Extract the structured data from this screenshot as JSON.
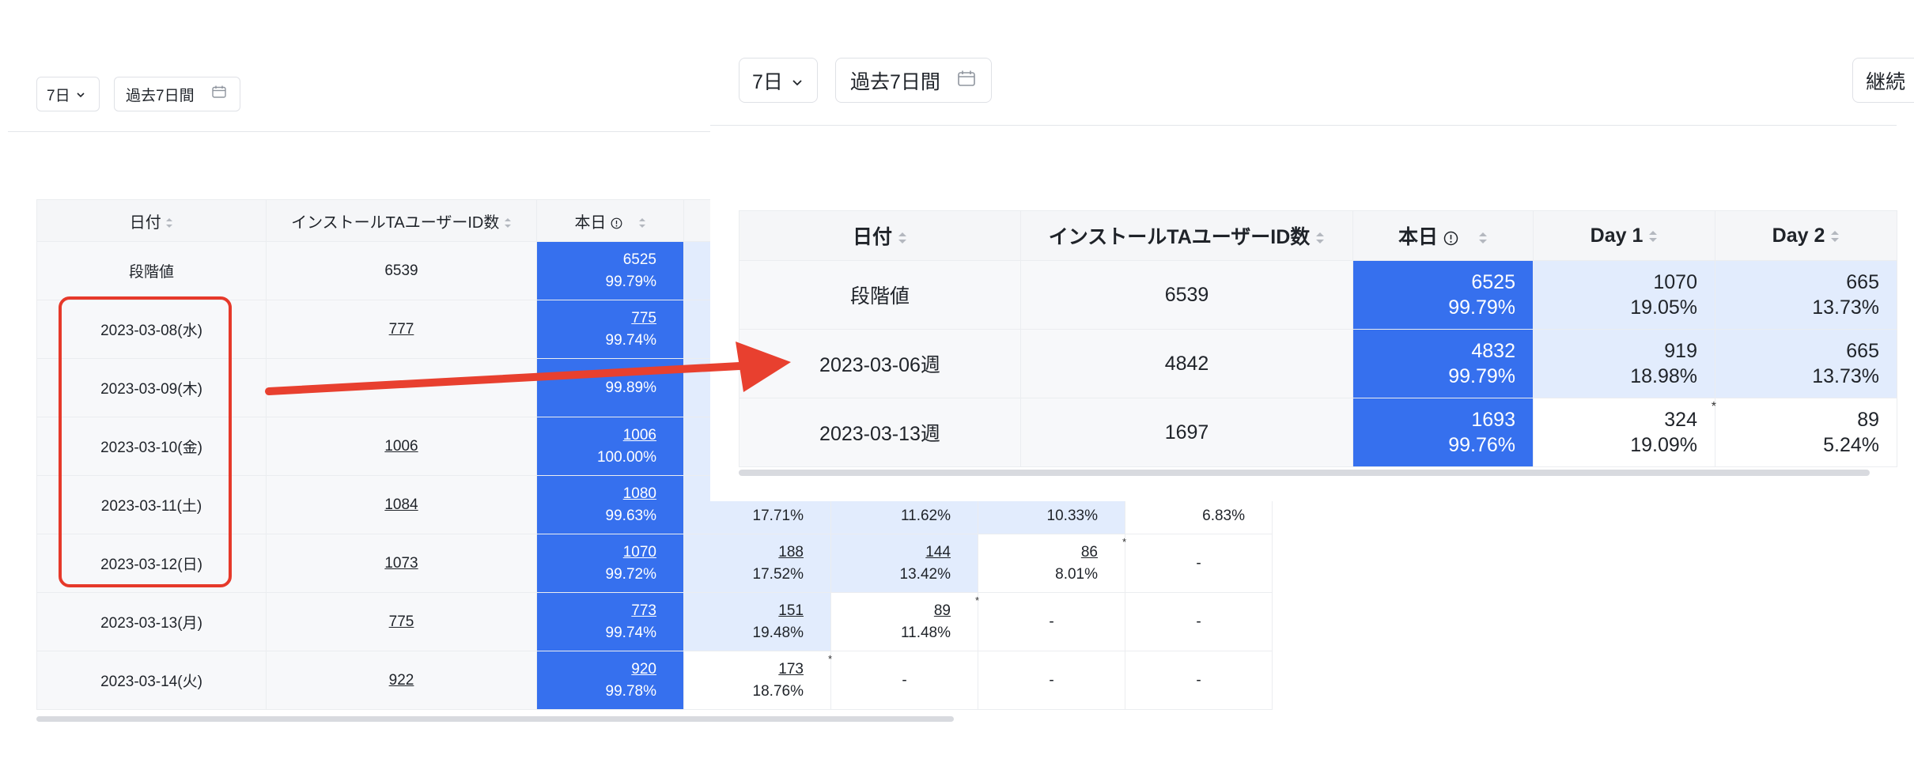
{
  "colors": {
    "accent_blue": "#3670ee",
    "light_blue": "#e2ecfd",
    "highlight_red": "#e6392a",
    "arrow_red": "#e8402f"
  },
  "left": {
    "controls": {
      "period": "7日",
      "range": "過去7日間"
    },
    "headers": {
      "date": "日付",
      "installs": "インストールTAユーザーID数",
      "today": "本日"
    },
    "rows": [
      {
        "date": "段階値",
        "installs": "6539",
        "today": "6525",
        "today_pct": "99.79%"
      },
      {
        "date": "2023-03-08(水)",
        "installs": "777",
        "today": "775",
        "today_pct": "99.74%"
      },
      {
        "date": "2023-03-09(木)",
        "installs": "",
        "today": "",
        "today_pct": "99.89%"
      },
      {
        "date": "2023-03-10(金)",
        "installs": "1006",
        "today": "1006",
        "today_pct": "100.00%"
      },
      {
        "date": "2023-03-11(土)",
        "installs": "1084",
        "today": "1080",
        "today_pct": "99.63%",
        "c1_pct": "17.71%",
        "c2_pct": "11.62%",
        "c3_pct": "10.33%",
        "c4_pct": "6.83%"
      },
      {
        "date": "2023-03-12(日)",
        "installs": "1073",
        "today": "1070",
        "today_pct": "99.72%",
        "c1": "188",
        "c1_pct": "17.52%",
        "c2": "144",
        "c2_pct": "13.42%",
        "c3": "86",
        "c3_pct": "8.01%",
        "c4": "-"
      },
      {
        "date": "2023-03-13(月)",
        "installs": "775",
        "today": "773",
        "today_pct": "99.74%",
        "c1": "151",
        "c1_pct": "19.48%",
        "c2": "89",
        "c2_pct": "11.48%",
        "c3": "-",
        "c4": "-"
      },
      {
        "date": "2023-03-14(火)",
        "installs": "922",
        "today": "920",
        "today_pct": "99.78%",
        "c1": "173",
        "c1_pct": "18.76%",
        "c2": "-",
        "c3": "-",
        "c4": "-"
      }
    ]
  },
  "right": {
    "controls": {
      "period": "7日",
      "range": "過去7日間",
      "continue_partial": "継続"
    },
    "headers": {
      "date": "日付",
      "installs": "インストールTAユーザーID数",
      "today": "本日",
      "day1": "Day 1",
      "day2": "Day 2"
    },
    "rows": [
      {
        "date": "段階値",
        "installs": "6539",
        "today": "6525",
        "today_pct": "99.79%",
        "d1": "1070",
        "d1_pct": "19.05%",
        "d2": "665",
        "d2_pct": "13.73%"
      },
      {
        "date": "2023-03-06週",
        "installs": "4842",
        "today": "4832",
        "today_pct": "99.79%",
        "d1": "919",
        "d1_pct": "18.98%",
        "d2": "665",
        "d2_pct": "13.73%"
      },
      {
        "date": "2023-03-13週",
        "installs": "1697",
        "today": "1693",
        "today_pct": "99.76%",
        "d1": "324",
        "d1_pct": "19.09%",
        "d2": "89",
        "d2_pct": "5.24%"
      }
    ]
  },
  "star": "*"
}
